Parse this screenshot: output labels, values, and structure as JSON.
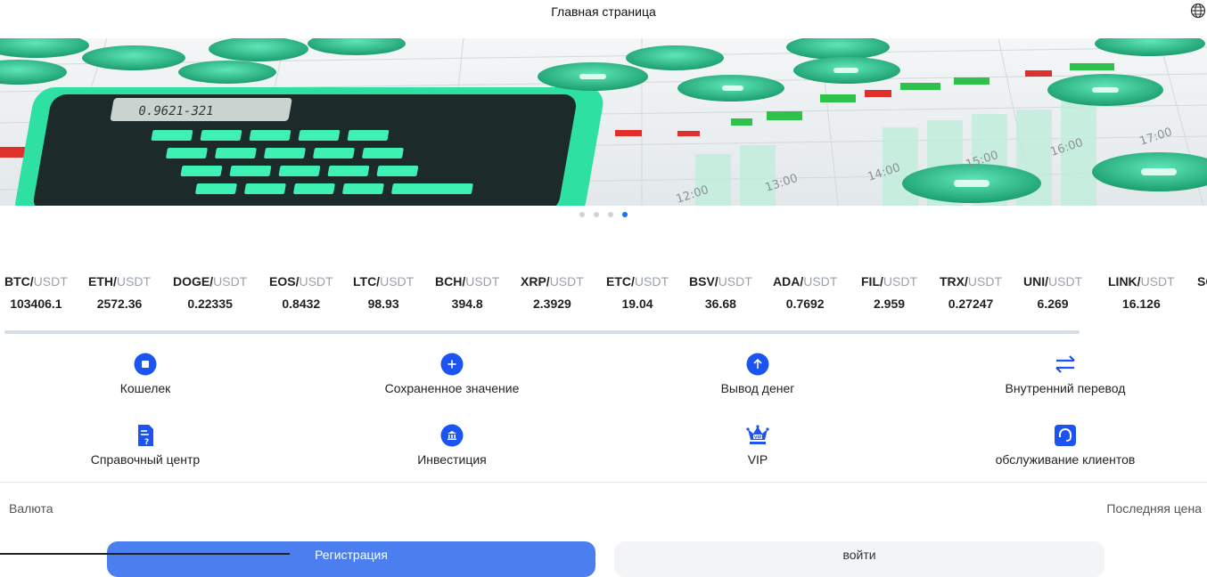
{
  "header": {
    "title": "Главная страница",
    "language_icon": "globe-icon"
  },
  "banner": {
    "slides_count": 4,
    "active_slide": 4,
    "image_text": {
      "calculator_display": "0.9621-321",
      "times": [
        "12:00",
        "13:00",
        "14:00",
        "15:00",
        "16:00",
        "17:00"
      ]
    }
  },
  "ticker": {
    "items": [
      {
        "base": "BTC/",
        "quote": "USDT",
        "price": "103406.1"
      },
      {
        "base": "ETH/",
        "quote": "USDT",
        "price": "2572.36"
      },
      {
        "base": "DOGE/",
        "quote": "USDT",
        "price": "0.22335"
      },
      {
        "base": "EOS/",
        "quote": "USDT",
        "price": "0.8432"
      },
      {
        "base": "LTC/",
        "quote": "USDT",
        "price": "98.93"
      },
      {
        "base": "BCH/",
        "quote": "USDT",
        "price": "394.8"
      },
      {
        "base": "XRP/",
        "quote": "USDT",
        "price": "2.3929"
      },
      {
        "base": "ETC/",
        "quote": "USDT",
        "price": "19.04"
      },
      {
        "base": "BSV/",
        "quote": "USDT",
        "price": "36.68"
      },
      {
        "base": "ADA/",
        "quote": "USDT",
        "price": "0.7692"
      },
      {
        "base": "FIL/",
        "quote": "USDT",
        "price": "2.959"
      },
      {
        "base": "TRX/",
        "quote": "USDT",
        "price": "0.27247"
      },
      {
        "base": "UNI/",
        "quote": "USDT",
        "price": "6.269"
      },
      {
        "base": "LINK/",
        "quote": "USDT",
        "price": "16.126"
      },
      {
        "base": "SC",
        "quote": "",
        "price": ""
      }
    ]
  },
  "actions": [
    {
      "label": "Кошелек",
      "icon": "wallet-icon"
    },
    {
      "label": "Сохраненное значение",
      "icon": "deposit-plus-icon"
    },
    {
      "label": "Вывод денег",
      "icon": "withdraw-arrow-icon"
    },
    {
      "label": "Внутренний перевод",
      "icon": "transfer-arrows-icon"
    },
    {
      "label": "Справочный центр",
      "icon": "help-document-icon"
    },
    {
      "label": "Инвестиция",
      "icon": "bank-icon"
    },
    {
      "label": "VIP",
      "icon": "vip-crown-icon"
    },
    {
      "label": "обслуживание клиентов",
      "icon": "headset-icon"
    }
  ],
  "market_table": {
    "col_currency": "Валюта",
    "col_last_price": "Последняя цена"
  },
  "auth": {
    "register_label": "Регистрация",
    "login_label": "войти"
  },
  "colors": {
    "accent": "#1b54f2",
    "register_bg": "#4b7ff0",
    "login_bg": "#f3f4f6",
    "quote_gray": "#9aa1ab",
    "active_dot": "#1b73e8",
    "banner_green": "#2fd39a"
  }
}
